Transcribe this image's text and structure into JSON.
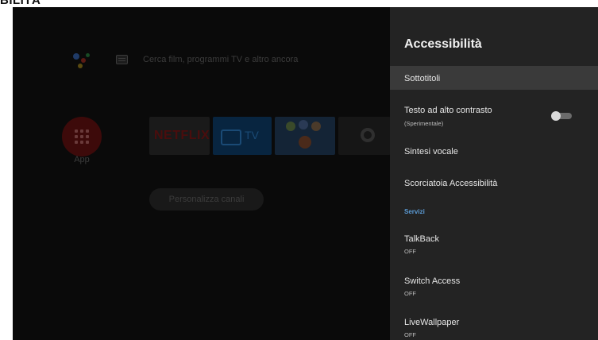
{
  "page_heading": "BILITÀ",
  "home": {
    "search_hint": "Cerca film, programmi TV e altro ancora",
    "apps_label": "App",
    "netflix_label": "NETFLIX",
    "tv_label": "TV",
    "customize_label": "Personalizza canali"
  },
  "panel": {
    "title": "Accessibilità",
    "items": [
      {
        "label": "Sottotitoli"
      },
      {
        "label": "Testo ad alto contrasto",
        "sub": "(Sperimentale)",
        "toggle_on": false
      },
      {
        "label": "Sintesi vocale"
      },
      {
        "label": "Scorciatoia Accessibilità"
      }
    ],
    "section": "Servizi",
    "services": [
      {
        "label": "TalkBack",
        "status": "OFF"
      },
      {
        "label": "Switch Access",
        "status": "OFF"
      },
      {
        "label": "LiveWallpaper",
        "status": "OFF"
      }
    ]
  },
  "colors": {
    "panel_bg": "#232323",
    "focus_bg": "#3a3a3a",
    "section_accent": "#5b9bd5",
    "background": "#0b0b0b"
  }
}
